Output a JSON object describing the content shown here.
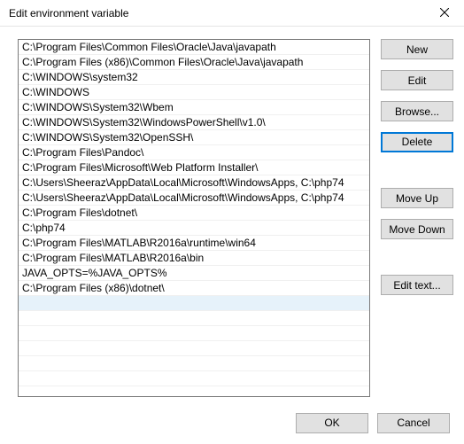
{
  "window": {
    "title": "Edit environment variable",
    "close_icon": "close"
  },
  "list": {
    "selectedIndex": 17,
    "items": [
      "C:\\Program Files\\Common Files\\Oracle\\Java\\javapath",
      "C:\\Program Files (x86)\\Common Files\\Oracle\\Java\\javapath",
      "C:\\WINDOWS\\system32",
      "C:\\WINDOWS",
      "C:\\WINDOWS\\System32\\Wbem",
      "C:\\WINDOWS\\System32\\WindowsPowerShell\\v1.0\\",
      "C:\\WINDOWS\\System32\\OpenSSH\\",
      "C:\\Program Files\\Pandoc\\",
      "C:\\Program Files\\Microsoft\\Web Platform Installer\\",
      "C:\\Users\\Sheeraz\\AppData\\Local\\Microsoft\\WindowsApps, C:\\php74",
      "C:\\Users\\Sheeraz\\AppData\\Local\\Microsoft\\WindowsApps, C:\\php74",
      "C:\\Program Files\\dotnet\\",
      "C:\\php74",
      "C:\\Program Files\\MATLAB\\R2016a\\runtime\\win64",
      "C:\\Program Files\\MATLAB\\R2016a\\bin",
      "JAVA_OPTS=%JAVA_OPTS%",
      "C:\\Program Files (x86)\\dotnet\\",
      ""
    ]
  },
  "buttons": {
    "new": "New",
    "edit": "Edit",
    "browse": "Browse...",
    "delete": "Delete",
    "moveup": "Move Up",
    "movedown": "Move Down",
    "edittext": "Edit text...",
    "ok": "OK",
    "cancel": "Cancel"
  }
}
